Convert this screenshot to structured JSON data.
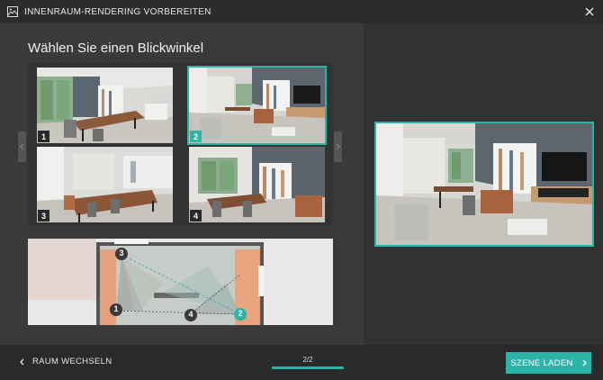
{
  "window": {
    "title": "INNENRAUM-RENDERING VORBEREITEN",
    "title_icon": "image-icon",
    "close_icon": "close-icon"
  },
  "main": {
    "heading": "Wählen Sie einen Blickwinkel",
    "thumbnails": [
      {
        "number": "1",
        "selected": false
      },
      {
        "number": "2",
        "selected": true
      },
      {
        "number": "3",
        "selected": false
      },
      {
        "number": "4",
        "selected": false
      }
    ],
    "floorplan_markers": [
      "1",
      "2",
      "3",
      "4"
    ]
  },
  "footer": {
    "back_label": "RAUM WECHSELN",
    "pager": "2/2",
    "load_label": "SZENE LADEN"
  },
  "colors": {
    "accent": "#2bb5a9",
    "background": "#3a3a3a",
    "titlebar": "#2c2c2c",
    "footer": "#2a2a2a"
  }
}
